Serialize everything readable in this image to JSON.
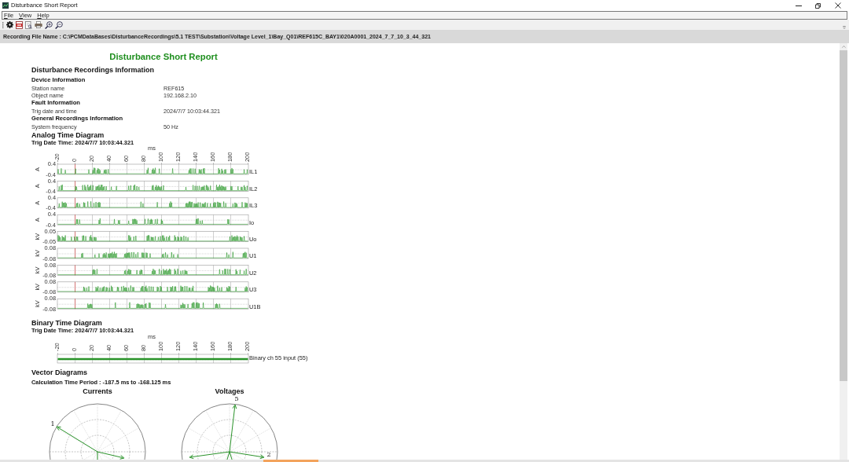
{
  "window": {
    "title": "Disturbance Short Report"
  },
  "menu": [
    "File",
    "View",
    "Help"
  ],
  "recording_file_name": "Recording File Name : C:\\PCMDataBases\\DisturbanceRecordings\\5.1 TEST\\Substation\\Voltage Level_1\\Bay_Q01\\REF615C_BAY1\\020A0001_2024_7_7_10_3_44_321",
  "report": {
    "title": "Disturbance Short Report",
    "heading": "Disturbance Recordings Information",
    "sections": [
      {
        "title": "Device Information",
        "rows": [
          {
            "label": "Station name",
            "value": "REF615"
          },
          {
            "label": "Object name",
            "value": "192.168.2.10"
          }
        ]
      },
      {
        "title": "Fault Information",
        "rows": [
          {
            "label": "Trig date and time",
            "value": "2024/7/7 10:03:44.321"
          }
        ]
      },
      {
        "title": "General Recordings Information",
        "rows": [
          {
            "label": "System frequency",
            "value": "50 Hz"
          }
        ]
      }
    ]
  },
  "analog_diagram": {
    "title": "Analog Time Diagram",
    "trig_time": "Trig Date Time: 2024/7/7 10:03:44.321",
    "x_unit": "ms",
    "x_ticks": [
      "-20",
      "0",
      "20",
      "40",
      "60",
      "80",
      "100",
      "120",
      "140",
      "160",
      "180",
      "200"
    ],
    "channels": [
      {
        "name": "IL1",
        "unit": "A",
        "max": "0.4",
        "min": "-0.4"
      },
      {
        "name": "IL2",
        "unit": "A",
        "max": "0.4",
        "min": "-0.4"
      },
      {
        "name": "IL3",
        "unit": "A",
        "max": "0.4",
        "min": "-0.4"
      },
      {
        "name": "Io",
        "unit": "A",
        "max": "0.4",
        "min": "-0.4"
      },
      {
        "name": "Uo",
        "unit": "kV",
        "max": "0.05",
        "min": "-0.05"
      },
      {
        "name": "U1",
        "unit": "kV",
        "max": "0.08",
        "min": "-0.08"
      },
      {
        "name": "U2",
        "unit": "kV",
        "max": "0.08",
        "min": "-0.08"
      },
      {
        "name": "U3",
        "unit": "kV",
        "max": "0.08",
        "min": "-0.08"
      },
      {
        "name": "U1B",
        "unit": "kV",
        "max": "0.08",
        "min": "-0.08"
      }
    ]
  },
  "binary_diagram": {
    "title": "Binary Time Diagram",
    "trig_time": "Trig Date Time: 2024/7/7 10:03:44.321",
    "x_unit": "ms",
    "x_ticks": [
      "-20",
      "0",
      "20",
      "40",
      "60",
      "80",
      "100",
      "120",
      "140",
      "160",
      "180",
      "200"
    ],
    "channels": [
      {
        "name": "Binary ch 55 input (55)"
      }
    ]
  },
  "vector_diagrams": {
    "title": "Vector Diagrams",
    "period": "Calculation Time Period : -187.5 ms to -168.125 ms",
    "plots": [
      {
        "title": "Currents",
        "labels": [
          "1"
        ]
      },
      {
        "title": "Voltages",
        "labels": [
          "5",
          "2"
        ]
      }
    ]
  }
}
